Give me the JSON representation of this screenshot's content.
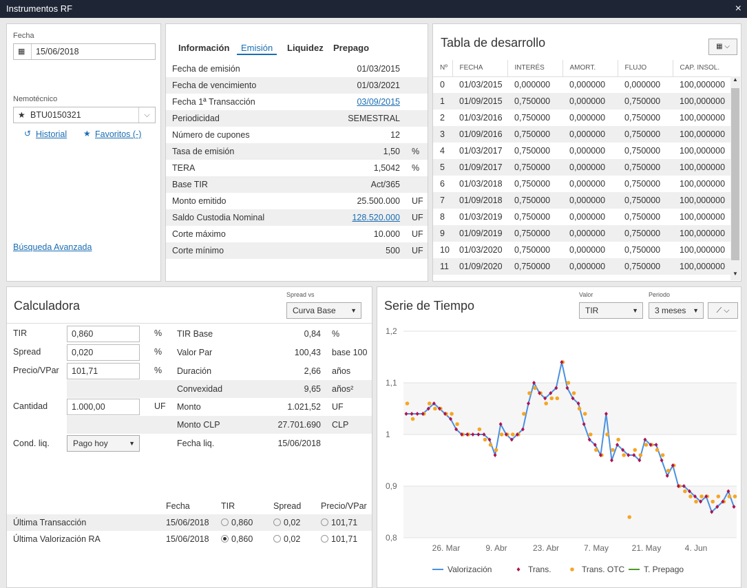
{
  "window": {
    "title": "Instrumentos RF",
    "close": "×"
  },
  "search": {
    "fecha_label": "Fecha",
    "fecha_value": "15/06/2018",
    "nemo_label": "Nemotécnico",
    "nemo_value": "BTU0150321",
    "historial": "Historial",
    "favoritos": "Favoritos (-)",
    "busqueda": "Búsqueda Avanzada"
  },
  "info": {
    "tabs": [
      "Información",
      "Emisión",
      "Liquidez",
      "Prepago"
    ],
    "active_tab": "Emisión",
    "rows": [
      {
        "label": "Fecha de emisión",
        "value": "01/03/2015",
        "unit": "",
        "link": false
      },
      {
        "label": "Fecha de vencimiento",
        "value": "01/03/2021",
        "unit": "",
        "link": false
      },
      {
        "label": "Fecha 1ª Transacción",
        "value": "03/09/2015",
        "unit": "",
        "link": true
      },
      {
        "label": "Periodicidad",
        "value": "SEMESTRAL",
        "unit": "",
        "link": false
      },
      {
        "label": "Número de cupones",
        "value": "12",
        "unit": "",
        "link": false
      },
      {
        "label": "Tasa de emisión",
        "value": "1,50",
        "unit": "%",
        "link": false
      },
      {
        "label": "TERA",
        "value": "1,5042",
        "unit": "%",
        "link": false
      },
      {
        "label": "Base TIR",
        "value": "Act/365",
        "unit": "",
        "link": false
      },
      {
        "label": "Monto emitido",
        "value": "25.500.000",
        "unit": "UF",
        "link": false
      },
      {
        "label": "Saldo Custodia Nominal",
        "value": "128.520.000",
        "unit": "UF",
        "link": true
      },
      {
        "label": "Corte máximo",
        "value": "10.000",
        "unit": "UF",
        "link": false
      },
      {
        "label": "Corte mínimo",
        "value": "500",
        "unit": "UF",
        "link": false
      }
    ]
  },
  "desarrollo": {
    "title": "Tabla de desarrollo",
    "headers": [
      "Nº",
      "FECHA",
      "INTERÉS",
      "AMORT.",
      "FLUJO",
      "CAP. INSOL."
    ],
    "rows": [
      [
        "0",
        "01/03/2015",
        "0,000000",
        "0,000000",
        "0,000000",
        "100,000000"
      ],
      [
        "1",
        "01/09/2015",
        "0,750000",
        "0,000000",
        "0,750000",
        "100,000000"
      ],
      [
        "2",
        "01/03/2016",
        "0,750000",
        "0,000000",
        "0,750000",
        "100,000000"
      ],
      [
        "3",
        "01/09/2016",
        "0,750000",
        "0,000000",
        "0,750000",
        "100,000000"
      ],
      [
        "4",
        "01/03/2017",
        "0,750000",
        "0,000000",
        "0,750000",
        "100,000000"
      ],
      [
        "5",
        "01/09/2017",
        "0,750000",
        "0,000000",
        "0,750000",
        "100,000000"
      ],
      [
        "6",
        "01/03/2018",
        "0,750000",
        "0,000000",
        "0,750000",
        "100,000000"
      ],
      [
        "7",
        "01/09/2018",
        "0,750000",
        "0,000000",
        "0,750000",
        "100,000000"
      ],
      [
        "8",
        "01/03/2019",
        "0,750000",
        "0,000000",
        "0,750000",
        "100,000000"
      ],
      [
        "9",
        "01/09/2019",
        "0,750000",
        "0,000000",
        "0,750000",
        "100,000000"
      ],
      [
        "10",
        "01/03/2020",
        "0,750000",
        "0,000000",
        "0,750000",
        "100,000000"
      ],
      [
        "11",
        "01/09/2020",
        "0,750000",
        "0,000000",
        "0,750000",
        "100,000000"
      ]
    ]
  },
  "calc": {
    "title": "Calculadora",
    "spread_vs_label": "Spread vs",
    "spread_vs_value": "Curva Base",
    "inputs": [
      {
        "label": "TIR",
        "value": "0,860",
        "unit": "%"
      },
      {
        "label": "Spread",
        "value": "0,020",
        "unit": "%"
      },
      {
        "label": "Precio/VPar",
        "value": "101,71",
        "unit": "%"
      },
      {
        "label": "Cantidad",
        "value": "1.000,00",
        "unit": "UF"
      }
    ],
    "cond_label": "Cond. liq.",
    "cond_value": "Pago hoy",
    "results": [
      {
        "label": "TIR Base",
        "value": "0,84",
        "unit": "%"
      },
      {
        "label": "Valor Par",
        "value": "100,43",
        "unit": "base 100"
      },
      {
        "label": "Duración",
        "value": "2,66",
        "unit": "años"
      },
      {
        "label": "Convexidad",
        "value": "9,65",
        "unit": "años²"
      },
      {
        "label": "Monto",
        "value": "1.021,52",
        "unit": "UF"
      },
      {
        "label": "Monto CLP",
        "value": "27.701.690",
        "unit": "CLP"
      },
      {
        "label": "Fecha liq.",
        "value": "15/06/2018",
        "unit": ""
      }
    ],
    "hist_headers": [
      "Fecha",
      "TIR",
      "Spread",
      "Precio/VPar"
    ],
    "hist_rows": [
      {
        "label": "Última Transacción",
        "fecha": "15/06/2018",
        "tir": "0,860",
        "spread": "0,02",
        "precio": "101,71",
        "selected": false
      },
      {
        "label": "Última Valorización RA",
        "fecha": "15/06/2018",
        "tir": "0,860",
        "spread": "0,02",
        "precio": "101,71",
        "selected": true
      }
    ]
  },
  "serie": {
    "title": "Serie de Tiempo",
    "valor_label": "Valor",
    "valor_value": "TIR",
    "periodo_label": "Periodo",
    "periodo_value": "3 meses"
  },
  "chart_data": {
    "type": "line",
    "ylim": [
      0.8,
      1.2
    ],
    "y_ticks": [
      "1,2",
      "1,1",
      "1",
      "0,9",
      "0,8"
    ],
    "x_ticks": [
      "26. Mar",
      "9. Abr",
      "23. Abr",
      "7. May",
      "21. May",
      "4. Jun"
    ],
    "grid": true,
    "legend": "bottom",
    "colors": {
      "Valorización": "#4a90e2",
      "Trans.": "#b0124f",
      "Trans. OTC": "#f5a623",
      "T. Prepago": "#4c9a2a"
    },
    "series": [
      {
        "name": "Valorización",
        "values": [
          1.04,
          1.04,
          1.04,
          1.04,
          1.05,
          1.06,
          1.05,
          1.04,
          1.03,
          1.01,
          1.0,
          1.0,
          1.0,
          1.0,
          1.0,
          0.99,
          0.96,
          1.02,
          1.0,
          0.99,
          1.0,
          1.01,
          1.06,
          1.1,
          1.08,
          1.07,
          1.08,
          1.09,
          1.14,
          1.09,
          1.07,
          1.06,
          1.02,
          0.99,
          0.98,
          0.96,
          1.04,
          0.95,
          0.98,
          0.97,
          0.96,
          0.96,
          0.95,
          0.99,
          0.98,
          0.98,
          0.95,
          0.92,
          0.94,
          0.9,
          0.9,
          0.89,
          0.88,
          0.87,
          0.88,
          0.85,
          0.86,
          0.87,
          0.89,
          0.86
        ]
      },
      {
        "name": "Trans.",
        "values": [
          1.04,
          1.04,
          1.04,
          1.04,
          1.05,
          1.06,
          1.05,
          1.04,
          1.03,
          1.01,
          1.0,
          1.0,
          1.0,
          1.0,
          1.0,
          0.99,
          0.96,
          1.02,
          1.0,
          0.99,
          1.0,
          1.01,
          1.06,
          1.1,
          1.08,
          1.07,
          1.08,
          1.09,
          1.14,
          1.09,
          1.07,
          1.06,
          1.02,
          0.99,
          0.98,
          0.96,
          1.04,
          0.95,
          0.98,
          0.97,
          0.96,
          0.96,
          0.95,
          0.99,
          0.98,
          0.98,
          0.95,
          0.92,
          0.94,
          0.9,
          0.9,
          0.89,
          0.88,
          0.87,
          0.88,
          0.85,
          0.86,
          0.87,
          0.89,
          0.86
        ]
      },
      {
        "name": "Trans. OTC",
        "values": [
          1.06,
          1.03,
          null,
          1.04,
          1.06,
          1.05,
          1.05,
          1.04,
          1.04,
          1.02,
          1.0,
          1.0,
          null,
          1.01,
          0.99,
          0.98,
          0.97,
          1.0,
          1.0,
          1.0,
          1.0,
          1.04,
          1.08,
          1.09,
          1.08,
          1.06,
          1.07,
          1.07,
          1.14,
          1.1,
          1.08,
          1.05,
          1.04,
          1.0,
          0.97,
          0.96,
          1.0,
          0.97,
          0.99,
          0.96,
          0.84,
          0.97,
          0.96,
          0.98,
          0.98,
          0.97,
          0.96,
          0.93,
          0.94,
          0.9,
          0.89,
          0.88,
          0.87,
          0.88,
          0.88,
          0.87,
          0.88,
          0.87,
          0.88,
          0.88
        ]
      },
      {
        "name": "T. Prepago",
        "values": []
      }
    ]
  }
}
